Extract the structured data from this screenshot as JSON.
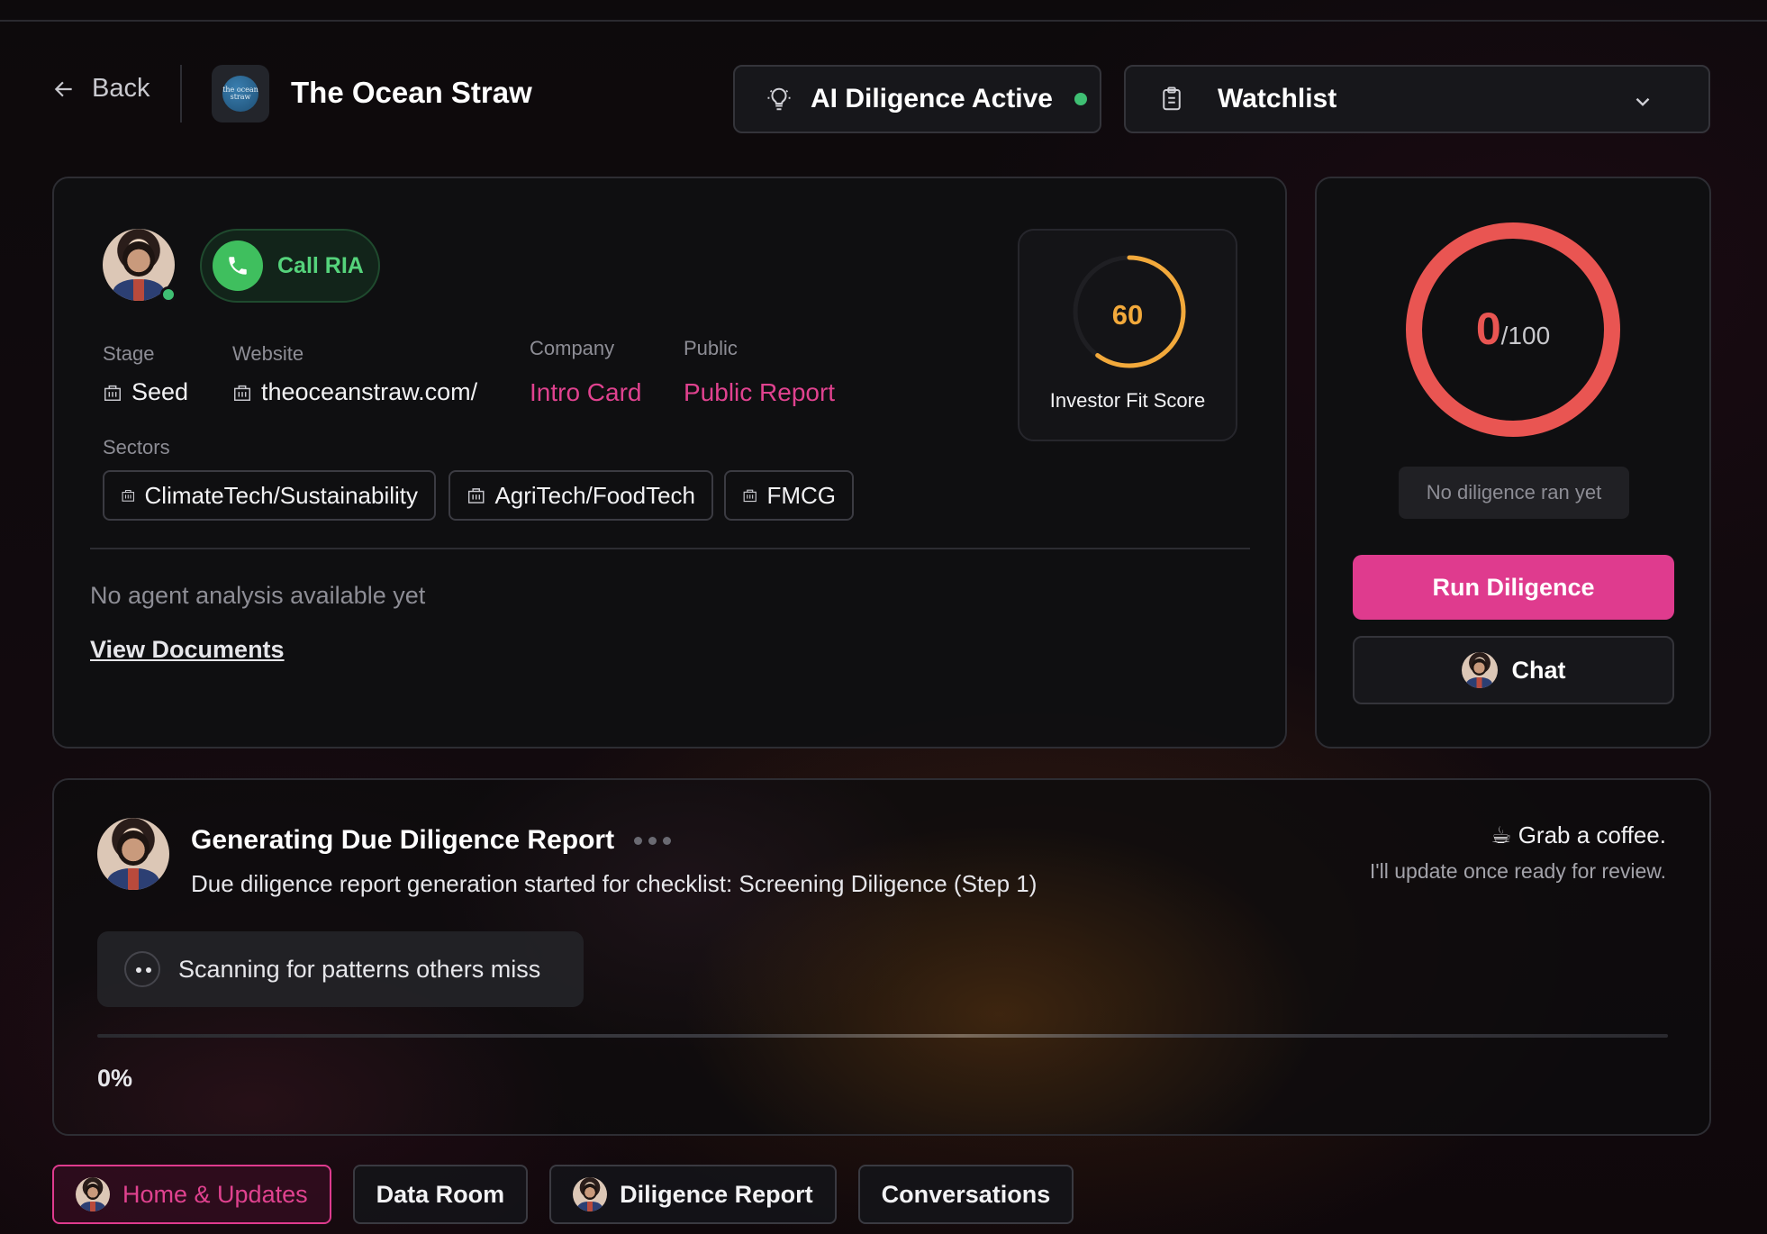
{
  "header": {
    "back_label": "Back",
    "company_name": "The Ocean Straw",
    "logo_text": "the ocean straw",
    "ai_status_label": "AI Diligence Active",
    "watchlist_label": "Watchlist"
  },
  "profile": {
    "call_label": "Call RIA",
    "fields": {
      "stage_label": "Stage",
      "stage_value": "Seed",
      "website_label": "Website",
      "website_value": "theoceanstraw.com/",
      "company_label": "Company",
      "company_link": "Intro Card",
      "public_label": "Public",
      "public_link": "Public Report",
      "sectors_label": "Sectors"
    },
    "sectors": [
      "ClimateTech/Sustainability",
      "AgriTech/FoodTech",
      "FMCG"
    ],
    "no_analysis_text": "No agent analysis available yet",
    "view_documents_label": "View Documents",
    "investor_fit": {
      "score": "60",
      "score_value": 60,
      "score_max": 100,
      "label": "Investor Fit Score"
    }
  },
  "diligence_panel": {
    "score": "0",
    "score_max": "/100",
    "status_text": "No diligence ran yet",
    "run_label": "Run Diligence",
    "chat_label": "Chat"
  },
  "report": {
    "title": "Generating Due Diligence Report",
    "description": "Due diligence report generation started for checklist: Screening Diligence (Step 1)",
    "coffee_title": "☕ Grab a coffee.",
    "coffee_sub": "I'll update once ready for review.",
    "scan_text": "Scanning for patterns others miss",
    "progress_percent": 0,
    "progress_label": "0%"
  },
  "tabs": [
    {
      "label": "Home & Updates",
      "active": true
    },
    {
      "label": "Data Room",
      "active": false
    },
    {
      "label": "Diligence Report",
      "active": false
    },
    {
      "label": "Conversations",
      "active": false
    }
  ],
  "colors": {
    "accent_pink": "#df3b8e",
    "success_green": "#3fbf73",
    "score_red": "#e95552",
    "fit_orange": "#f2a93b"
  }
}
